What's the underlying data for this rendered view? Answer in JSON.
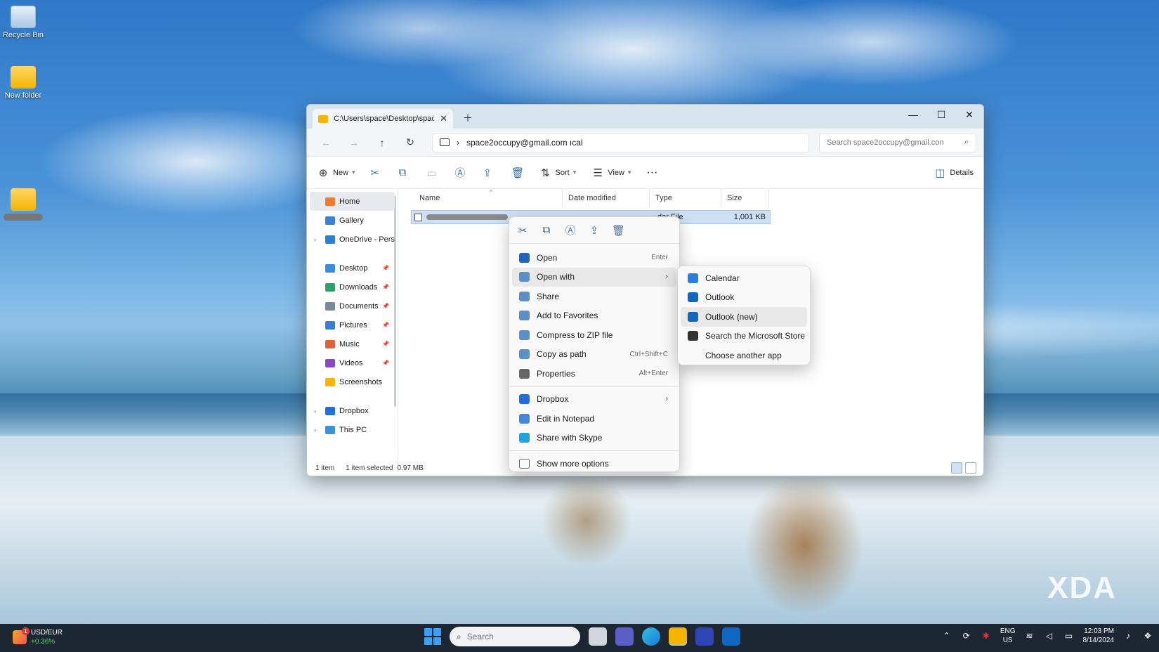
{
  "desktop": {
    "icons": [
      {
        "label": "Recycle Bin"
      },
      {
        "label": "New folder"
      }
    ],
    "watermark": "XDA"
  },
  "explorer": {
    "tab_title": "C:\\Users\\space\\Desktop\\space",
    "address": "space2occupy@gmail.com ıcal",
    "search_placeholder": "Search space2occupy@gmail.con",
    "commands": {
      "new": "New",
      "sort": "Sort",
      "view": "View",
      "details": "Details"
    },
    "sidebar": [
      {
        "label": "Home",
        "icon_color": "#f07b2a",
        "active": true
      },
      {
        "label": "Gallery",
        "icon_color": "#3b82d6"
      },
      {
        "label": "OneDrive - Pers",
        "icon_color": "#2a7fd4",
        "chevron": true
      },
      {
        "label": "Desktop",
        "icon_color": "#3b8be0",
        "pinned": true
      },
      {
        "label": "Downloads",
        "icon_color": "#2aa36b",
        "pinned": true
      },
      {
        "label": "Documents",
        "icon_color": "#7a8a9a",
        "pinned": true
      },
      {
        "label": "Pictures",
        "icon_color": "#3a7dd8",
        "pinned": true
      },
      {
        "label": "Music",
        "icon_color": "#e0603a",
        "pinned": true
      },
      {
        "label": "Videos",
        "icon_color": "#8a46c8",
        "pinned": true
      },
      {
        "label": "Screenshots",
        "icon_color": "#f4b400"
      },
      {
        "label": "Dropbox",
        "icon_color": "#1f6fe0",
        "chevron": true
      },
      {
        "label": "This PC",
        "icon_color": "#3a92d8",
        "chevron": true
      }
    ],
    "columns": {
      "name": "Name",
      "date": "Date modified",
      "type": "Type",
      "size": "Size"
    },
    "file": {
      "type": "dar File",
      "size": "1,001 KB"
    },
    "status": {
      "items": "1 item",
      "selected": "1 item selected",
      "sel_size": "0.97 MB"
    }
  },
  "context_menu": {
    "items": [
      {
        "label": "Open",
        "shortcut": "Enter",
        "icon_color": "#1f66c1"
      },
      {
        "label": "Open with",
        "shortcut": "",
        "submenu": true,
        "icon_color": "#5b8fc8"
      },
      {
        "label": "Share",
        "shortcut": "",
        "icon_color": "#5b8fc8"
      },
      {
        "label": "Add to Favorites",
        "shortcut": "",
        "icon_color": "#5b8fc8"
      },
      {
        "label": "Compress to ZIP file",
        "shortcut": "",
        "icon_color": "#5b8fc8"
      },
      {
        "label": "Copy as path",
        "shortcut": "Ctrl+Shift+C",
        "icon_color": "#5b8fc8"
      },
      {
        "label": "Properties",
        "shortcut": "Alt+Enter",
        "icon_color": "#666666"
      }
    ],
    "items2": [
      {
        "label": "Dropbox",
        "submenu": true,
        "icon_color": "#1f6fe0"
      },
      {
        "label": "Edit in Notepad",
        "icon_color": "#3f89d6"
      },
      {
        "label": "Share with Skype",
        "icon_color": "#1ea3e0"
      }
    ],
    "more": "Show more options"
  },
  "open_with_submenu": [
    {
      "label": "Calendar",
      "icon_color": "#2a7de0"
    },
    {
      "label": "Outlook",
      "icon_color": "#1166c1"
    },
    {
      "label": "Outlook (new)",
      "icon_color": "#1166c1"
    },
    {
      "label": "Search the Microsoft Store",
      "icon_color": "#333333"
    },
    {
      "label": "Choose another app",
      "icon_color": ""
    }
  ],
  "taskbar": {
    "widget_title": "USD/EUR",
    "widget_change": "+0.36%",
    "widget_badge": "1",
    "search_placeholder": "Search",
    "lang_top": "ENG",
    "lang_bottom": "US",
    "time": "12:03 PM",
    "date": "8/14/2024"
  }
}
